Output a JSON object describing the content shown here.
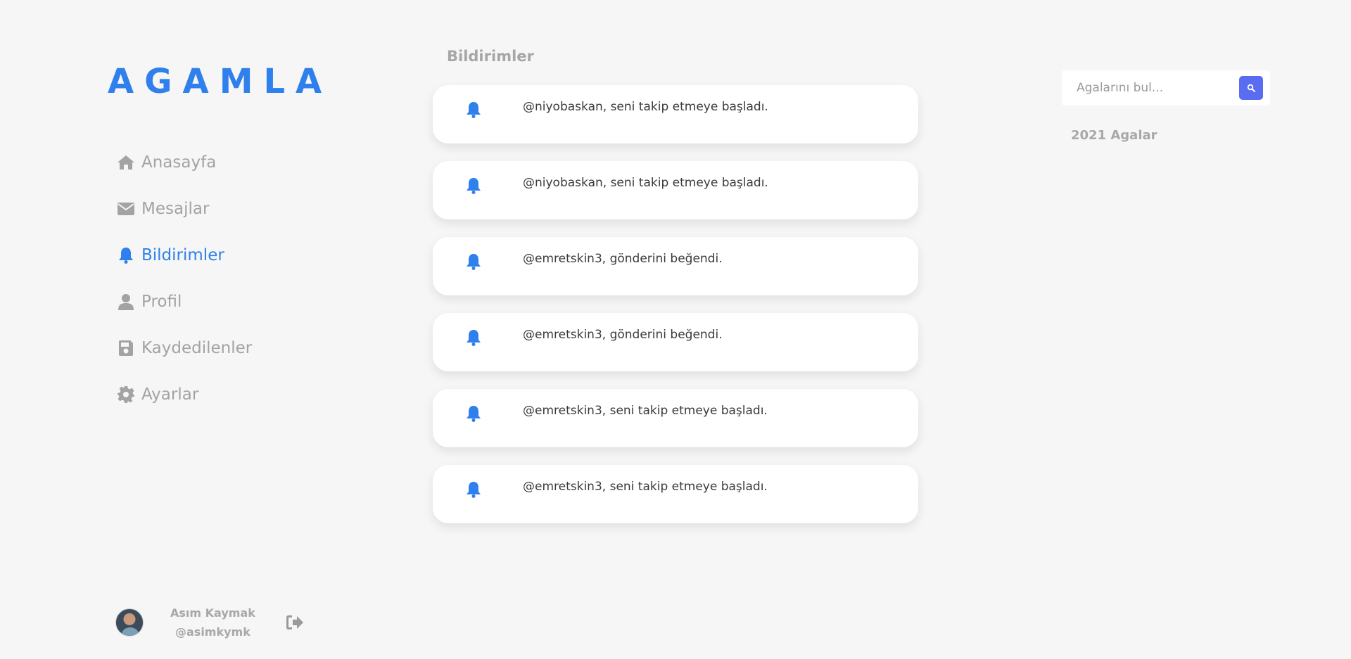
{
  "brand": {
    "logo_text": "AGAMLA",
    "accent_color": "#2f80ed"
  },
  "nav": {
    "items": [
      {
        "label": "Anasayfa",
        "icon": "home-icon"
      },
      {
        "label": "Mesajlar",
        "icon": "envelope-icon"
      },
      {
        "label": "Bildirimler",
        "icon": "bell-icon",
        "active": true
      },
      {
        "label": "Profil",
        "icon": "user-icon"
      },
      {
        "label": "Kaydedilenler",
        "icon": "save-icon"
      },
      {
        "label": "Ayarlar",
        "icon": "gear-icon"
      }
    ]
  },
  "user": {
    "name": "Asım Kaymak",
    "handle": "@asimkymk"
  },
  "main": {
    "title": "Bildirimler",
    "notifications": [
      {
        "text": "@niyobaskan, seni takip etmeye başladı."
      },
      {
        "text": "@niyobaskan, seni takip etmeye başladı."
      },
      {
        "text": "@emretskin3, gönderini beğendi."
      },
      {
        "text": "@emretskin3, gönderini beğendi."
      },
      {
        "text": "@emretskin3, seni takip etmeye başladı."
      },
      {
        "text": "@emretskin3, seni takip etmeye başladı."
      }
    ]
  },
  "search": {
    "placeholder": "Agalarını bul..."
  },
  "right": {
    "title": "2021 Agalar"
  }
}
